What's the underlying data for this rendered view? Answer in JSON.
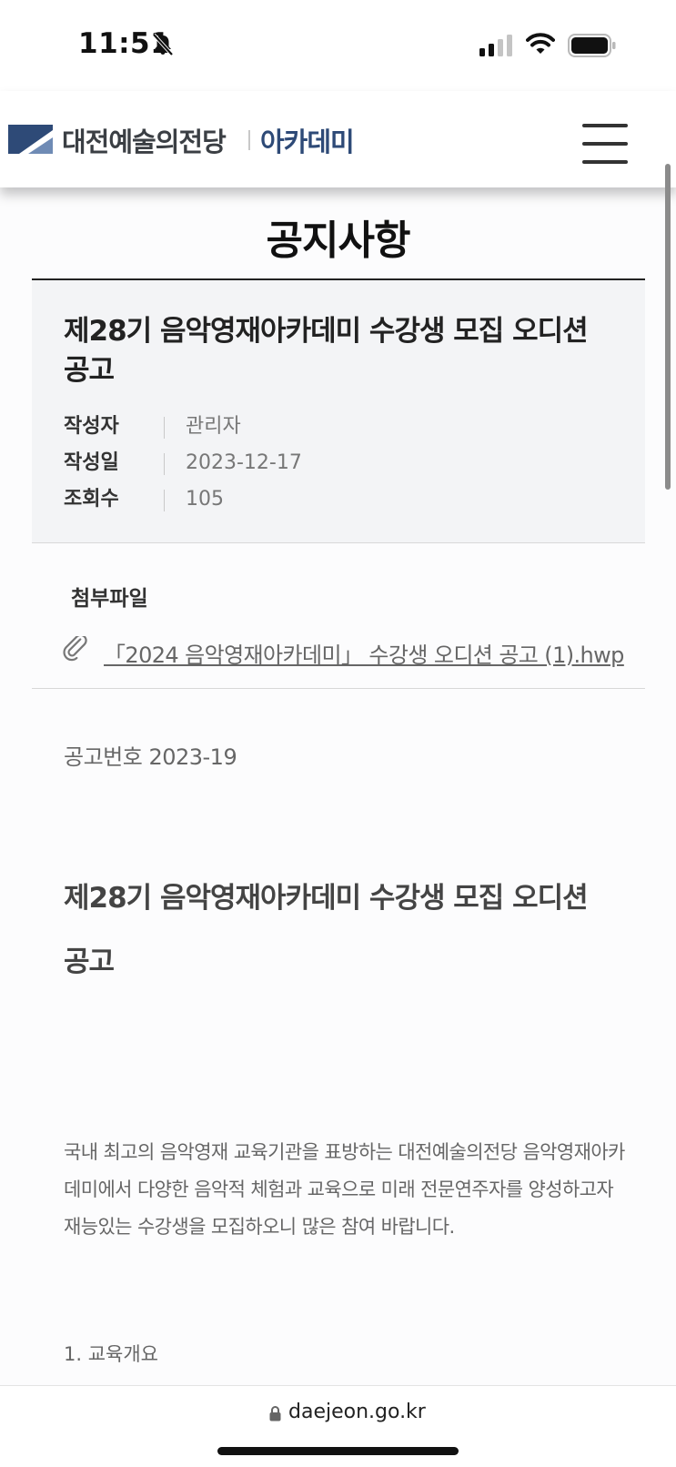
{
  "status_bar": {
    "time": "11:51",
    "battery_level": 0.85
  },
  "header": {
    "logo_text": "대전예술의전당",
    "logo_sub": "아카데미",
    "brand_color": "#2e4a77"
  },
  "page_title": "공지사항",
  "notice": {
    "title": "제28기 음악영재아카데미 수강생 모집 오디션 공고",
    "meta": [
      {
        "label": "작성자",
        "value": "관리자"
      },
      {
        "label": "작성일",
        "value": "2023-12-17"
      },
      {
        "label": "조회수",
        "value": "105"
      }
    ]
  },
  "attachment": {
    "label": "첨부파일",
    "file_name": "「2024 음악영재아카데미」 수강생 오디션 공고 (1).hwp",
    "icon": "paperclip-icon"
  },
  "body": {
    "notice_number": "공고번호 2023-19",
    "heading": "제28기 음악영재아카데미 수강생 모집 오디션 공고",
    "paragraph": "국내 최고의 음악영재 교육기관을 표방하는 대전예술의전당 음악영재아카데미에서 다양한 음악적 체험과 교육으로 미래 전문연주자를 양성하고자 재능있는 수강생을 모집하오니 많은 참여 바랍니다.",
    "section_1": "1. 교육개요"
  },
  "browser": {
    "url": "daejeon.go.kr"
  }
}
